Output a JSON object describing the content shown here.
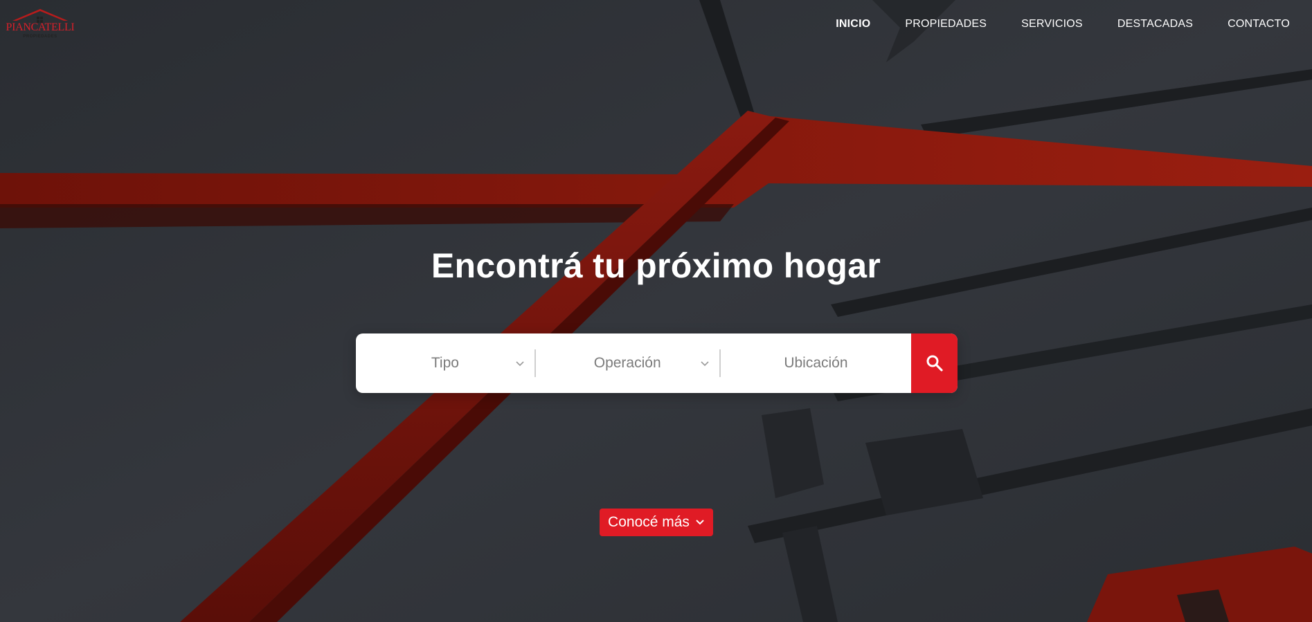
{
  "brand": {
    "name": "PIANCATELLI",
    "subtitle": "PROPIEDADES",
    "accent_color": "#e01b25"
  },
  "nav": {
    "items": [
      {
        "label": "INICIO",
        "active": true
      },
      {
        "label": "PROPIEDADES",
        "active": false
      },
      {
        "label": "SERVICIOS",
        "active": false
      },
      {
        "label": "DESTACADAS",
        "active": false
      },
      {
        "label": "CONTACTO",
        "active": false
      }
    ]
  },
  "hero": {
    "title": "Encontrá tu próximo hogar"
  },
  "search": {
    "tipo_label": "Tipo",
    "operacion_label": "Operación",
    "ubicacion_placeholder": "Ubicación",
    "button_icon": "search-icon"
  },
  "cta": {
    "label": "Conocé más",
    "icon": "chevron-down-icon"
  }
}
